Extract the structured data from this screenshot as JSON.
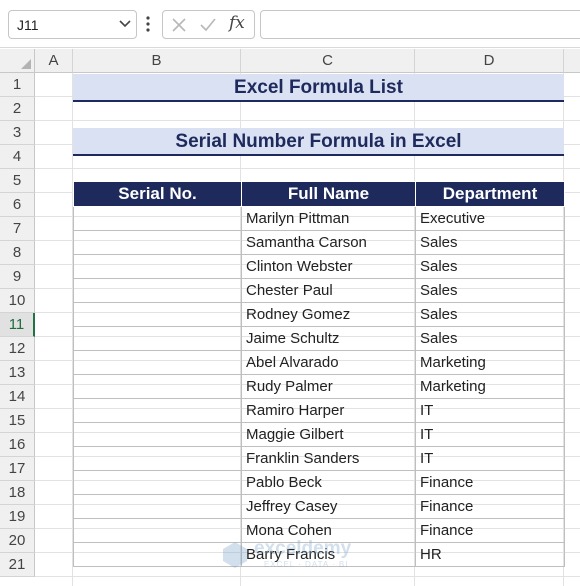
{
  "formula_bar": {
    "name_box": "J11",
    "fx_label": "fx",
    "formula": ""
  },
  "columns": [
    "A",
    "B",
    "C",
    "D"
  ],
  "rows": [
    "1",
    "2",
    "3",
    "4",
    "5",
    "6",
    "7",
    "8",
    "9",
    "10",
    "11",
    "12",
    "13",
    "14",
    "15",
    "16",
    "17",
    "18",
    "19",
    "20",
    "21"
  ],
  "active_row": "11",
  "sheet": {
    "title": "Excel Formula List",
    "subtitle": "Serial Number Formula in Excel",
    "table": {
      "headers": [
        "Serial No.",
        "Full Name",
        "Department"
      ],
      "rows": [
        [
          "",
          "Marilyn Pittman",
          "Executive"
        ],
        [
          "",
          "Samantha Carson",
          "Sales"
        ],
        [
          "",
          "Clinton Webster",
          "Sales"
        ],
        [
          "",
          "Chester Paul",
          "Sales"
        ],
        [
          "",
          "Rodney Gomez",
          "Sales"
        ],
        [
          "",
          "Jaime Schultz",
          "Sales"
        ],
        [
          "",
          "Abel Alvarado",
          "Marketing"
        ],
        [
          "",
          "Rudy Palmer",
          "Marketing"
        ],
        [
          "",
          "Ramiro Harper",
          "IT"
        ],
        [
          "",
          "Maggie Gilbert",
          "IT"
        ],
        [
          "",
          "Franklin Sanders",
          "IT"
        ],
        [
          "",
          "Pablo Beck",
          "Finance"
        ],
        [
          "",
          "Jeffrey Casey",
          "Finance"
        ],
        [
          "",
          "Mona Cohen",
          "Finance"
        ],
        [
          "",
          "Barry Francis",
          "HR"
        ]
      ]
    }
  },
  "watermark": {
    "brand": "exceldemy",
    "tagline": "EXCEL · DATA · BI"
  },
  "colors": {
    "header_fill": "#1f2a5c",
    "title_fill": "#d9e1f2",
    "active_accent": "#217346"
  }
}
